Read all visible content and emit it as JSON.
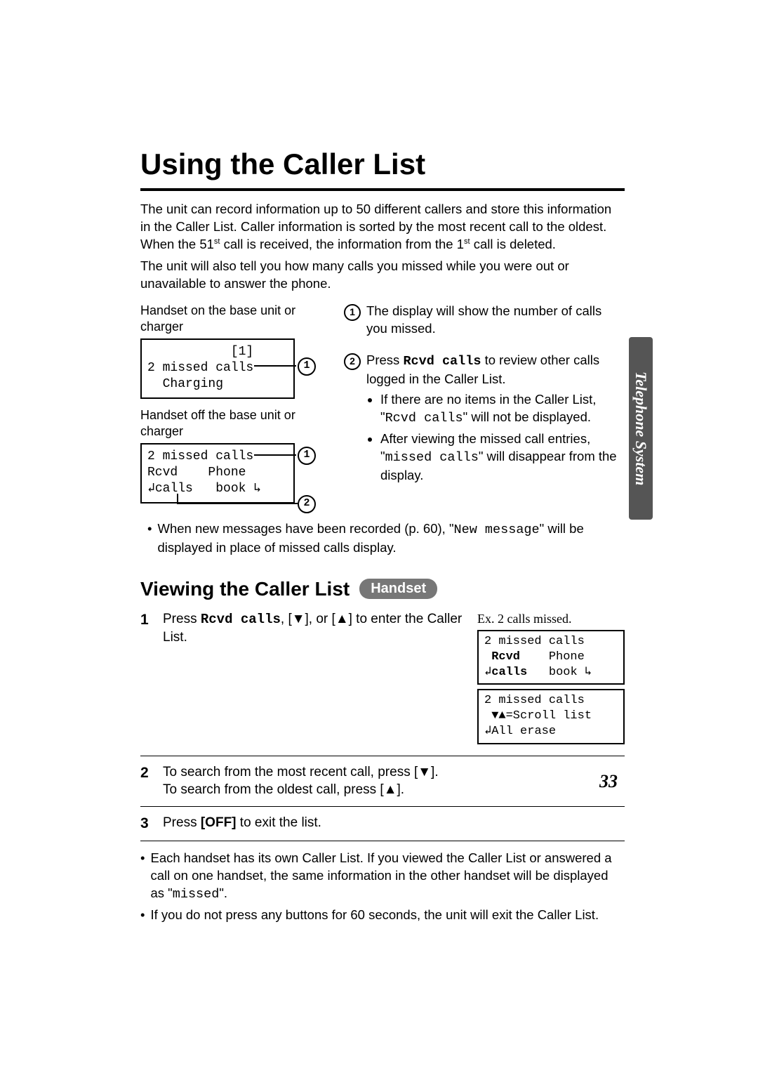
{
  "title": "Using the Caller List",
  "intro1": "The unit can record information up to 50 different callers and store this information in the Caller List. Caller information is sorted by the most recent call to the oldest. When the 51st call is received, the information from the 1st call is deleted.",
  "intro2": "The unit will also tell you how many calls you missed while you were out or unavailable to answer the phone.",
  "caption1": "Handset on the base unit or charger",
  "lcd1_r1": "           [1]",
  "lcd1_r2": "2 missed calls",
  "lcd1_r3": "  Charging",
  "caption2": "Handset off the base unit or charger",
  "lcd2_r1": "2 missed calls",
  "lcd2_r2": "Rcvd    Phone",
  "lcd2_r3": "↲calls   book ↳",
  "callout1_text": "The display will show the number of calls you missed.",
  "callout2_lead": "Press ",
  "callout2_key": "Rcvd calls",
  "callout2_rest": " to review other calls logged in the Caller List.",
  "callout2_b1a": "If there are no items in the Caller List, \"",
  "callout2_b1b": "Rcvd calls",
  "callout2_b1c": "\" will not be displayed.",
  "callout2_b2a": "After viewing the missed call entries, \"",
  "callout2_b2b": "missed calls",
  "callout2_b2c": "\" will disappear from the display.",
  "note1a": "When new messages have been recorded (p. 60), \"",
  "note1b": "New message",
  "note1c": "\" will be displayed in place of missed calls display.",
  "subhead": "Viewing the Caller List",
  "badge": "Handset",
  "step1a": "Press ",
  "step1b": "Rcvd calls",
  "step1c": ", [▼], or [▲] to enter the Caller List.",
  "ex_label": "Ex. 2 calls missed.",
  "ex1_r1": "2 missed calls",
  "ex1_r2": " Rcvd    Phone",
  "ex1_r2_bold": "Rcvd",
  "ex1_r3": "↲calls   book ↳",
  "ex1_r3_bold": "calls",
  "ex2_r1": "2 missed calls",
  "ex2_r2": " ▼▲=Scroll list",
  "ex2_r3": "↲All erase",
  "step2a": "To search from the most recent call, press [▼].",
  "step2b": "To search from the oldest call, press [▲].",
  "step3a": "Press ",
  "step3b": "[OFF]",
  "step3c": " to exit the list.",
  "foot1a": "Each handset has its own Caller List. If you viewed the Caller List or answered a call on one handset, the same information in the other handset will be displayed as \"",
  "foot1b": "missed",
  "foot1c": "\".",
  "foot2": "If you do not press any buttons for 60 seconds, the unit will exit the Caller List.",
  "side_tab": "Telephone System",
  "page_num": "33"
}
